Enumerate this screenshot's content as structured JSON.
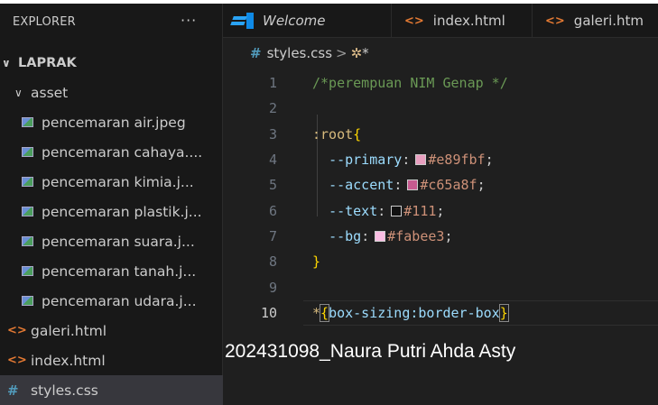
{
  "sidebar": {
    "title": "EXPLORER",
    "more": "···",
    "root_folder": "LAPRAK",
    "sub_folder": "asset",
    "asset_files": [
      "pencemaran air.jpeg",
      "pencemaran cahaya....",
      "pencemaran kimia.j...",
      "pencemaran plastik.j...",
      "pencemaran suara.j...",
      "pencemaran tanah.j...",
      "pencemaran udara.j..."
    ],
    "root_files": [
      "galeri.html",
      "index.html",
      "styles.css"
    ],
    "selected_file": "styles.css"
  },
  "tabs": [
    {
      "label": "Welcome",
      "icon": "vscode-logo-icon"
    },
    {
      "label": "index.html",
      "icon": "html-icon"
    },
    {
      "label": "galeri.htm",
      "icon": "html-icon"
    }
  ],
  "breadcrumb": {
    "file": "styles.css",
    "separator": ">",
    "symbol": "*"
  },
  "code": {
    "line1": "/*perempuan NIM Genap */",
    "line3_selector": ":root",
    "line4_prop": "--primary",
    "line4_val": "#e89fbf",
    "line5_prop": "--accent",
    "line5_val": "#c65a8f",
    "line6_prop": "--text",
    "line6_val": "#111",
    "line7_prop": "--bg",
    "line7_val": "#fabee3",
    "line10_selector": "*",
    "line10_body": "box-sizing:border-box"
  },
  "line_numbers": [
    "1",
    "2",
    "3",
    "4",
    "5",
    "6",
    "7",
    "8",
    "9",
    "10"
  ],
  "colors": {
    "primary_swatch": "#e89fbf",
    "accent_swatch": "#c65a8f",
    "text_swatch": "#111111",
    "bg_swatch": "#fabee3"
  },
  "caption": "202431098_Naura Putri Ahda Asty"
}
